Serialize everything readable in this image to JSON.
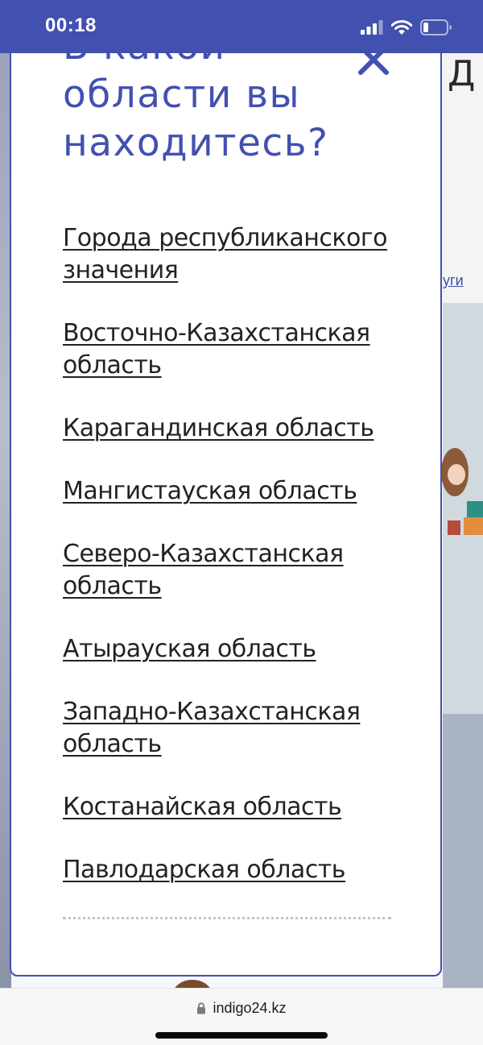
{
  "status_bar": {
    "time": "00:18",
    "icons": [
      "signal-icon",
      "wifi-icon",
      "battery-icon"
    ]
  },
  "background": {
    "partial_char": "Д",
    "partial_link": "уги"
  },
  "modal": {
    "title": "В какой области вы находитесь?",
    "close_icon": "close-icon",
    "regions": [
      {
        "label": "Города республиканского значения"
      },
      {
        "label": "Восточно-Казахстанская область"
      },
      {
        "label": "Карагандинская область"
      },
      {
        "label": "Мангистауская область"
      },
      {
        "label": "Северо-Казахстанская область"
      },
      {
        "label": "Атырауская область"
      },
      {
        "label": "Западно-Казахстанская область"
      },
      {
        "label": "Костанайская область"
      },
      {
        "label": "Павлодарская область"
      }
    ]
  },
  "browser": {
    "url": "indigo24.kz",
    "lock_icon": "lock-icon"
  },
  "colors": {
    "accent": "#4250b0",
    "text": "#222222",
    "background": "#ffffff"
  }
}
